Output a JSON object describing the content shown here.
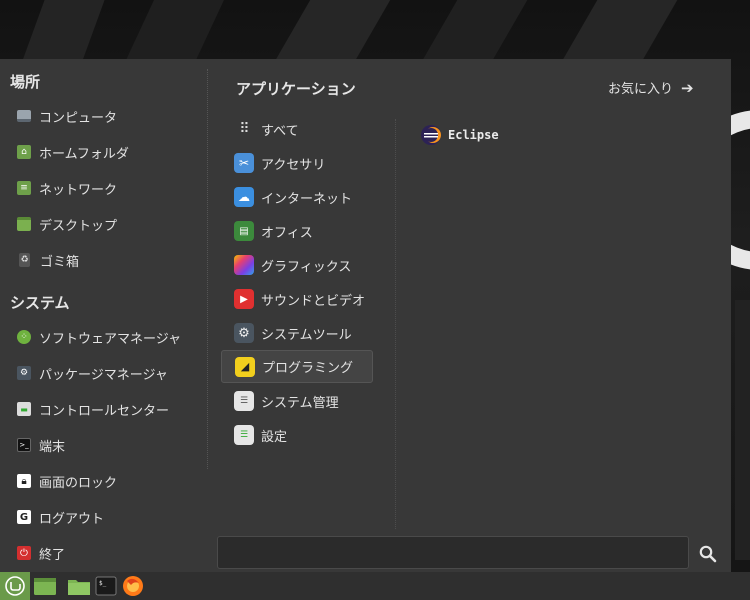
{
  "places": {
    "title": "場所",
    "items": [
      {
        "label": "コンピュータ",
        "icon": "computer-icon"
      },
      {
        "label": "ホームフォルダ",
        "icon": "home-folder-icon"
      },
      {
        "label": "ネットワーク",
        "icon": "network-folder-icon"
      },
      {
        "label": "デスクトップ",
        "icon": "desktop-folder-icon"
      },
      {
        "label": "ゴミ箱",
        "icon": "trash-icon"
      }
    ]
  },
  "system": {
    "title": "システム",
    "items": [
      {
        "label": "ソフトウェアマネージャ",
        "icon": "software-manager-icon"
      },
      {
        "label": "パッケージマネージャ",
        "icon": "package-manager-icon"
      },
      {
        "label": "コントロールセンター",
        "icon": "control-center-icon"
      },
      {
        "label": "端末",
        "icon": "terminal-icon"
      },
      {
        "label": "画面のロック",
        "icon": "lock-icon"
      },
      {
        "label": "ログアウト",
        "icon": "logout-icon"
      },
      {
        "label": "終了",
        "icon": "power-icon"
      }
    ]
  },
  "applications": {
    "title": "アプリケーション",
    "favorites_label": "お気に入り",
    "categories": [
      {
        "label": "すべて",
        "icon": "grid-icon"
      },
      {
        "label": "アクセサリ",
        "icon": "scissors-icon"
      },
      {
        "label": "インターネット",
        "icon": "cloud-icon"
      },
      {
        "label": "オフィス",
        "icon": "office-icon"
      },
      {
        "label": "グラフィックス",
        "icon": "graphics-icon"
      },
      {
        "label": "サウンドとビデオ",
        "icon": "play-icon"
      },
      {
        "label": "システムツール",
        "icon": "gear-icon"
      },
      {
        "label": "プログラミング",
        "icon": "programming-icon",
        "selected": true
      },
      {
        "label": "システム管理",
        "icon": "admin-toggle-icon"
      },
      {
        "label": "設定",
        "icon": "settings-toggle-icon"
      }
    ],
    "apps": [
      {
        "label": "Eclipse",
        "icon": "eclipse-icon"
      }
    ]
  },
  "search": {
    "value": "",
    "placeholder": ""
  },
  "panel": {
    "launchers": [
      "mint-menu-icon",
      "files-icon",
      "folder-icon",
      "terminal-icon",
      "firefox-icon"
    ]
  }
}
